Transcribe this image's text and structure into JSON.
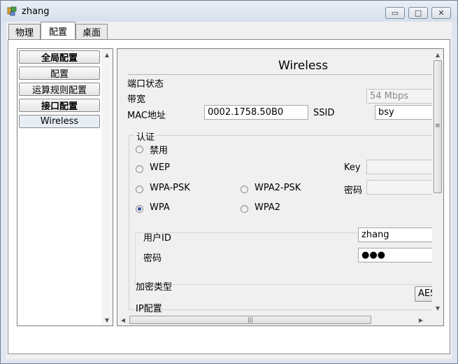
{
  "window": {
    "title": "zhang"
  },
  "titlebar_buttons": {
    "minimize": "▭",
    "maximize": "□",
    "close": "✕"
  },
  "tabs": [
    {
      "label": "物理"
    },
    {
      "label": "配置"
    },
    {
      "label": "桌面"
    }
  ],
  "active_tab": "配置",
  "sidebar": {
    "items": [
      {
        "label": "全局配置"
      },
      {
        "label": "配置"
      },
      {
        "label": "运算规则配置"
      },
      {
        "label": "接口配置"
      },
      {
        "label": "Wireless"
      }
    ]
  },
  "scroll_arrows": {
    "up": "▲",
    "down": "▼",
    "left": "◀",
    "right": "▶",
    "grip_h": "|||",
    "grip_v": "≡"
  },
  "panel": {
    "title": "Wireless",
    "port_status_label": "端口状态",
    "bandwidth_label": "带宽",
    "bandwidth_value": "54 Mbps",
    "mac_label": "MAC地址",
    "mac_value": "0002.1758.50B0",
    "ssid_label": "SSID",
    "ssid_value": "bsy",
    "auth_group_label": "认证",
    "auth_options": {
      "disabled": "禁用",
      "wep": "WEP",
      "wpa_psk": "WPA-PSK",
      "wpa2_psk": "WPA2-PSK",
      "wpa": "WPA",
      "wpa2": "WPA2"
    },
    "selected_auth": "WPA",
    "key_label": "Key",
    "key_value": "",
    "psk_password_label": "密码",
    "psk_password_value": "",
    "user_id_label": "用户ID",
    "user_id_value": "zhang",
    "password_label": "密码",
    "password_value": "●●●",
    "encryption_label": "加密类型",
    "encryption_value": "AES",
    "ip_config_label": "IP配置"
  }
}
